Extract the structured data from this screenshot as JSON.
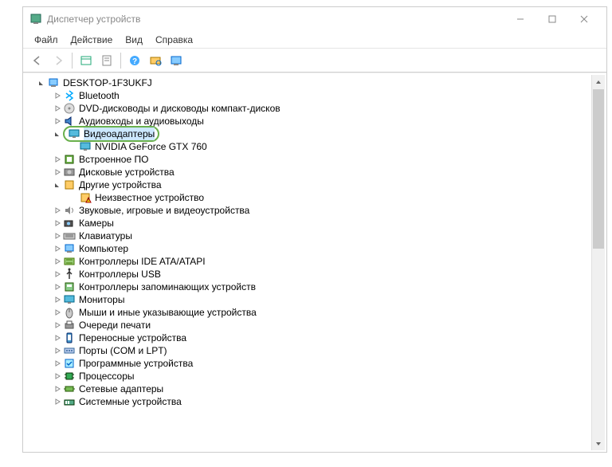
{
  "window": {
    "title": "Диспетчер устройств"
  },
  "menu": {
    "file": "Файл",
    "action": "Действие",
    "view": "Вид",
    "help": "Справка"
  },
  "tree": {
    "root": "DESKTOP-1F3UKFJ",
    "items": [
      {
        "label": "Bluetooth",
        "exp": "closed"
      },
      {
        "label": "DVD-дисководы и дисководы компакт-дисков",
        "exp": "closed"
      },
      {
        "label": "Аудиовходы и аудиовыходы",
        "exp": "closed"
      },
      {
        "label": "Видеоадаптеры",
        "exp": "open",
        "highlight": true,
        "children": [
          {
            "label": "NVIDIA GeForce GTX 760"
          }
        ]
      },
      {
        "label": "Встроенное ПО",
        "exp": "closed"
      },
      {
        "label": "Дисковые устройства",
        "exp": "closed"
      },
      {
        "label": "Другие устройства",
        "exp": "open",
        "children": [
          {
            "label": "Неизвестное устройство",
            "warn": true
          }
        ]
      },
      {
        "label": "Звуковые, игровые и видеоустройства",
        "exp": "closed"
      },
      {
        "label": "Камеры",
        "exp": "closed"
      },
      {
        "label": "Клавиатуры",
        "exp": "closed"
      },
      {
        "label": "Компьютер",
        "exp": "closed"
      },
      {
        "label": "Контроллеры IDE ATA/ATAPI",
        "exp": "closed"
      },
      {
        "label": "Контроллеры USB",
        "exp": "closed"
      },
      {
        "label": "Контроллеры запоминающих устройств",
        "exp": "closed"
      },
      {
        "label": "Мониторы",
        "exp": "closed"
      },
      {
        "label": "Мыши и иные указывающие устройства",
        "exp": "closed"
      },
      {
        "label": "Очереди печати",
        "exp": "closed"
      },
      {
        "label": "Переносные устройства",
        "exp": "closed"
      },
      {
        "label": "Порты (COM и LPT)",
        "exp": "closed"
      },
      {
        "label": "Программные устройства",
        "exp": "closed"
      },
      {
        "label": "Процессоры",
        "exp": "closed"
      },
      {
        "label": "Сетевые адаптеры",
        "exp": "closed"
      },
      {
        "label": "Системные устройства",
        "exp": "closed"
      }
    ]
  }
}
